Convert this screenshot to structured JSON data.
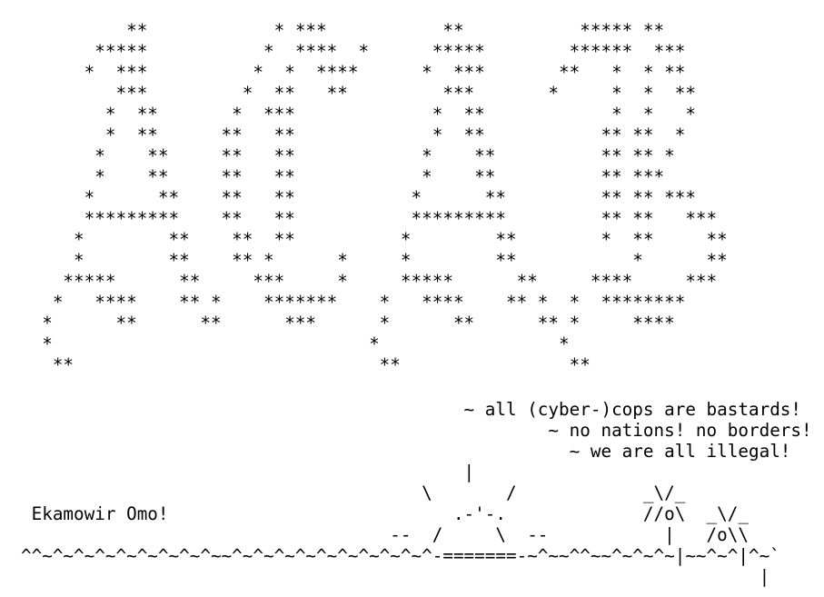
{
  "art": {
    "lines": [
      "          **            * ***           **           ***** **",
      "       *****           *  ****  *      *****        ******  ***",
      "      *  ***          *  *  ****      *  ***       **   *  * **",
      "         ***         *  **   **         ***       *     *  *  **",
      "        *  **       *  ***             *  **            *  *   *",
      "        *  **      **   **             *  **           ** **  *",
      "       *    **     **   **            *    **          ** ** *",
      "       *    **     **   **            *    **          ** ***",
      "      *      **    **   **           *      **         ** ** ***",
      "      *********    **   **           *********         ** **   ***",
      "     *        **    **  **          *        **        *  **     **",
      "     *        **    ** *      *     *        **           *      **",
      "    *****      **     ***     *     *****      **     ****     ***",
      "   *   ****    ** *    *******    *   ****    ** *  *  ********",
      "  *      **      **      ***      *      **      ** *     ****",
      "  *                              *                 *",
      "   **                             **                **",
      "",
      "                                          ~ all (cyber-)cops are bastards!",
      "                                                  ~ no nations! no borders!",
      "                                                    ~ we are all illegal!",
      "                                          |",
      "                                      \\       /            _\\/_",
      " Ekamowir Omo!                           .-'-.             //o\\  _\\/_",
      "                                   --  /     \\  --           |   /o\\\\",
      "^^~^~^~^~^~^~^~^~^~~^~^~^~^~^~^~^~^~^~^-=======-~^~~^^~~^~^~^~|~~^~^|^~`",
      "                                                                      |"
    ]
  }
}
